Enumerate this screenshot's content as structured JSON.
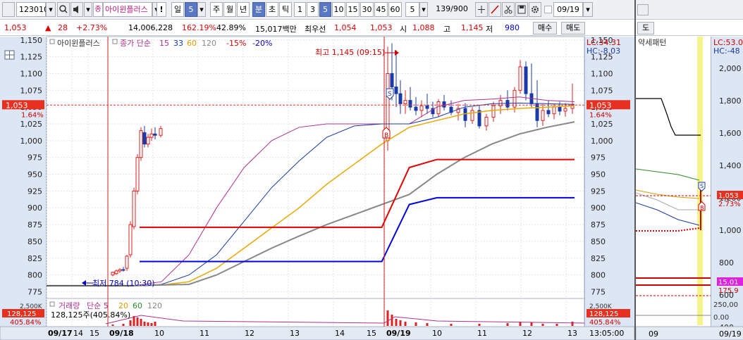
{
  "toolbar": {
    "code": "123010",
    "name_prefix": "종",
    "name": "아이윈플러스",
    "warn": "!",
    "period_day": "일",
    "period_day_n": "5",
    "periods": [
      "주",
      "월",
      "년"
    ],
    "minute": "분",
    "tick_label": "초",
    "tick": "틱",
    "intervals": [
      "1",
      "3",
      "5",
      "10",
      "15",
      "30",
      "45",
      "60"
    ],
    "selected_interval": "5",
    "count_n": "5",
    "count": "139/900",
    "date": "09/19"
  },
  "quote": {
    "price": "1,053",
    "arrow": "▲",
    "change": "28",
    "change_pct": "+2.73%",
    "volume": "14,006,228",
    "vol_ratio": "162.19%",
    "turnover": "42.89%",
    "amount": "15,017백만",
    "bid_label": "최우선",
    "bid": "1,054",
    "ask": "1,053",
    "open_label": "시",
    "open": "1,088",
    "high_label": "고",
    "high": "1,145",
    "low_label": "저",
    "low": "980",
    "buy": "매수",
    "sell": "매도"
  },
  "legend": {
    "name": "아이윈플러스",
    "ma_label": "종가 단순",
    "ma_periods": [
      "15",
      "33",
      "60",
      "120"
    ],
    "env_up": "-15%",
    "env_dn": "-20%",
    "vol_label": "거래량",
    "vol_ma": "단순 5",
    "vol_periods": [
      "20",
      "60",
      "120"
    ],
    "vol_value": "128,125주(405.84%)"
  },
  "annotations": {
    "high": "최고 1,145 (09:15)",
    "low": "최저 784 (10:30)",
    "lc": "LC:34.31",
    "hc": "HC:-8.03",
    "price_tag": "1,053",
    "pct_tag": "1.64%",
    "vol_tag": "128,125",
    "vol_pct_tag": "405.84%",
    "vol_axis_top": "2,500K",
    "time": "13:05:00",
    "sig_s": "S",
    "sig_b": "B"
  },
  "mini": {
    "top_label": "도",
    "title": "약세패턴",
    "lc": "LC:53.0",
    "hc": "HC:-48",
    "axis": [
      "2,000",
      "1,800",
      "1,600",
      "1,400",
      "1,200",
      "1,000",
      "800",
      "600",
      "400"
    ],
    "price_tag": "1,053",
    "pct_tag": "2.73%",
    "vol_tag": "15.01",
    "vol_pct": "175.9",
    "vol_axis": [
      "250,00",
      "0.00"
    ],
    "date_left": "09",
    "date_right": "09/19"
  },
  "chart_data": {
    "type": "line",
    "title": "",
    "xlabel": "",
    "ylabel": "",
    "ylim": [
      765,
      1155
    ],
    "yticks": [
      1150,
      1125,
      1100,
      1075,
      1050,
      1025,
      1000,
      975,
      950,
      925,
      900,
      875,
      850,
      825,
      800,
      775
    ],
    "x_labels": [
      "09/17",
      "14",
      "15",
      "09/18",
      "10",
      "11",
      "12",
      "13",
      "14",
      "15",
      "09/19",
      "10",
      "11",
      "12",
      "13"
    ],
    "series": [
      {
        "name": "15",
        "values": [
          784,
          790,
          830,
          900,
          960,
          1000,
          1020,
          1025,
          1025,
          1025,
          1025,
          1050,
          1060,
          1062,
          1065,
          1060,
          1058
        ]
      },
      {
        "name": "33",
        "values": [
          784,
          786,
          800,
          830,
          880,
          930,
          970,
          1005,
          1022,
          1025,
          1025,
          1035,
          1050,
          1055,
          1056,
          1055,
          1054
        ]
      },
      {
        "name": "60",
        "values": [
          784,
          785,
          790,
          810,
          840,
          870,
          900,
          935,
          965,
          995,
          1020,
          1030,
          1040,
          1045,
          1048,
          1050,
          1052
        ]
      },
      {
        "name": "120",
        "values": [
          784,
          785,
          786,
          800,
          820,
          840,
          858,
          875,
          890,
          905,
          920,
          950,
          975,
          995,
          1010,
          1020,
          1028
        ]
      },
      {
        "name": "-15%",
        "values": [
          null,
          null,
          871,
          871,
          871,
          871,
          871,
          871,
          871,
          871,
          960,
          972,
          972,
          972,
          972,
          972,
          972
        ]
      },
      {
        "name": "-20%",
        "values": [
          null,
          null,
          820,
          820,
          820,
          820,
          820,
          820,
          820,
          820,
          905,
          915,
          915,
          915,
          915,
          915,
          915
        ]
      }
    ],
    "price_last": 1053,
    "high": 1145,
    "low": 784
  }
}
